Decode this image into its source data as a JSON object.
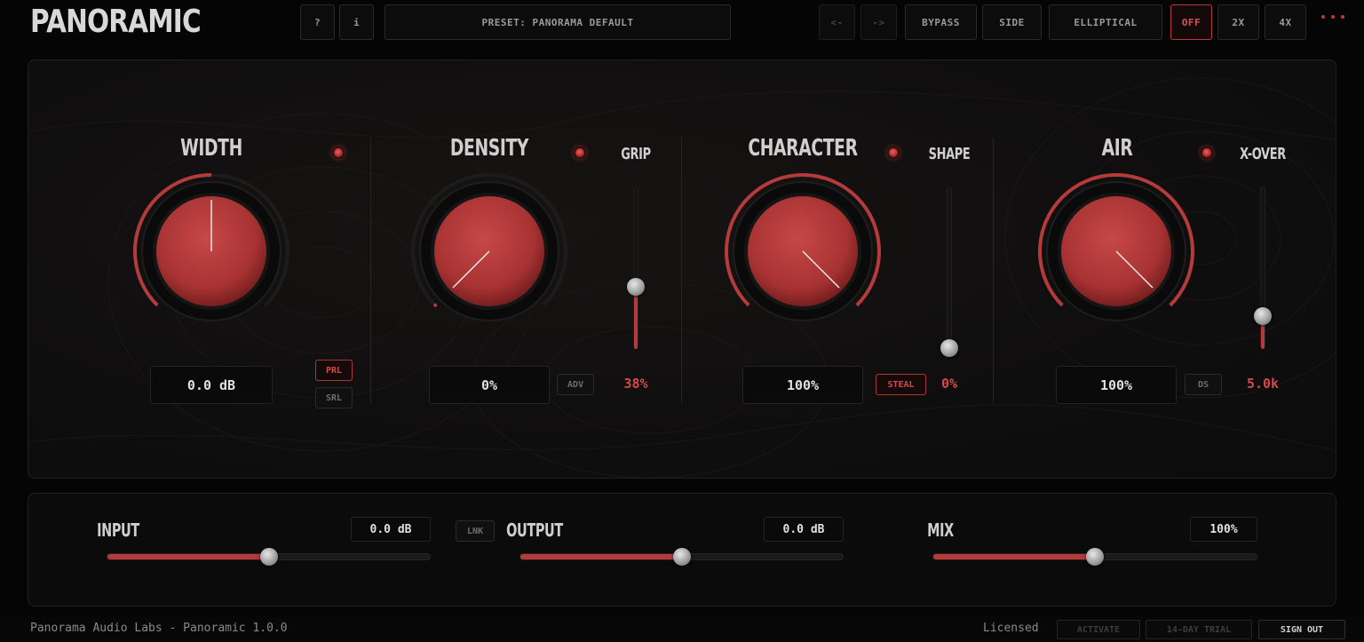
{
  "header": {
    "logo": "PANORAMIC",
    "help_label": "?",
    "info_label": "i",
    "preset_label": "PRESET: PANORAMA DEFAULT",
    "prev_label": "<-",
    "next_label": "->",
    "bypass_label": "BYPASS",
    "side_label": "SIDE",
    "elliptical_label": "ELLIPTICAL",
    "off_label": "OFF",
    "x2_label": "2X",
    "x4_label": "4X"
  },
  "sections": {
    "width": {
      "title": "WIDTH",
      "value": "0.0 dB",
      "prl_label": "PRL",
      "srl_label": "SRL",
      "knob_fraction": 0.5
    },
    "density": {
      "title": "DENSITY",
      "value": "0%",
      "adv_label": "ADV",
      "knob_fraction": 0.0
    },
    "grip": {
      "title": "GRIP",
      "value": "38%",
      "fraction": 0.38
    },
    "character": {
      "title": "CHARACTER",
      "value": "100%",
      "steal_label": "STEAL",
      "knob_fraction": 1.0
    },
    "shape": {
      "title": "SHAPE",
      "value": "0%",
      "fraction": 0.0
    },
    "air": {
      "title": "AIR",
      "value": "100%",
      "ds_label": "DS",
      "knob_fraction": 1.0
    },
    "xover": {
      "title": "X-OVER",
      "value": "5.0k",
      "fraction": 0.2
    }
  },
  "bottom": {
    "input": {
      "label": "INPUT",
      "value": "0.0 dB",
      "fraction": 0.5
    },
    "link_label": "LNK",
    "output": {
      "label": "OUTPUT",
      "value": "0.0 dB",
      "fraction": 0.5
    },
    "mix": {
      "label": "MIX",
      "value": "100%",
      "fraction": 0.5
    }
  },
  "footer": {
    "company": "Panorama Audio Labs - Panoramic 1.0.0",
    "status": "Licensed",
    "activate_label": "ACTIVATE",
    "trial_label": "14-DAY TRIAL",
    "signout_label": "SIGN OUT"
  },
  "colors": {
    "accent": "#b53a3a",
    "accent_bright": "#d24a4a",
    "background": "#050505",
    "knob": "#a83232"
  }
}
